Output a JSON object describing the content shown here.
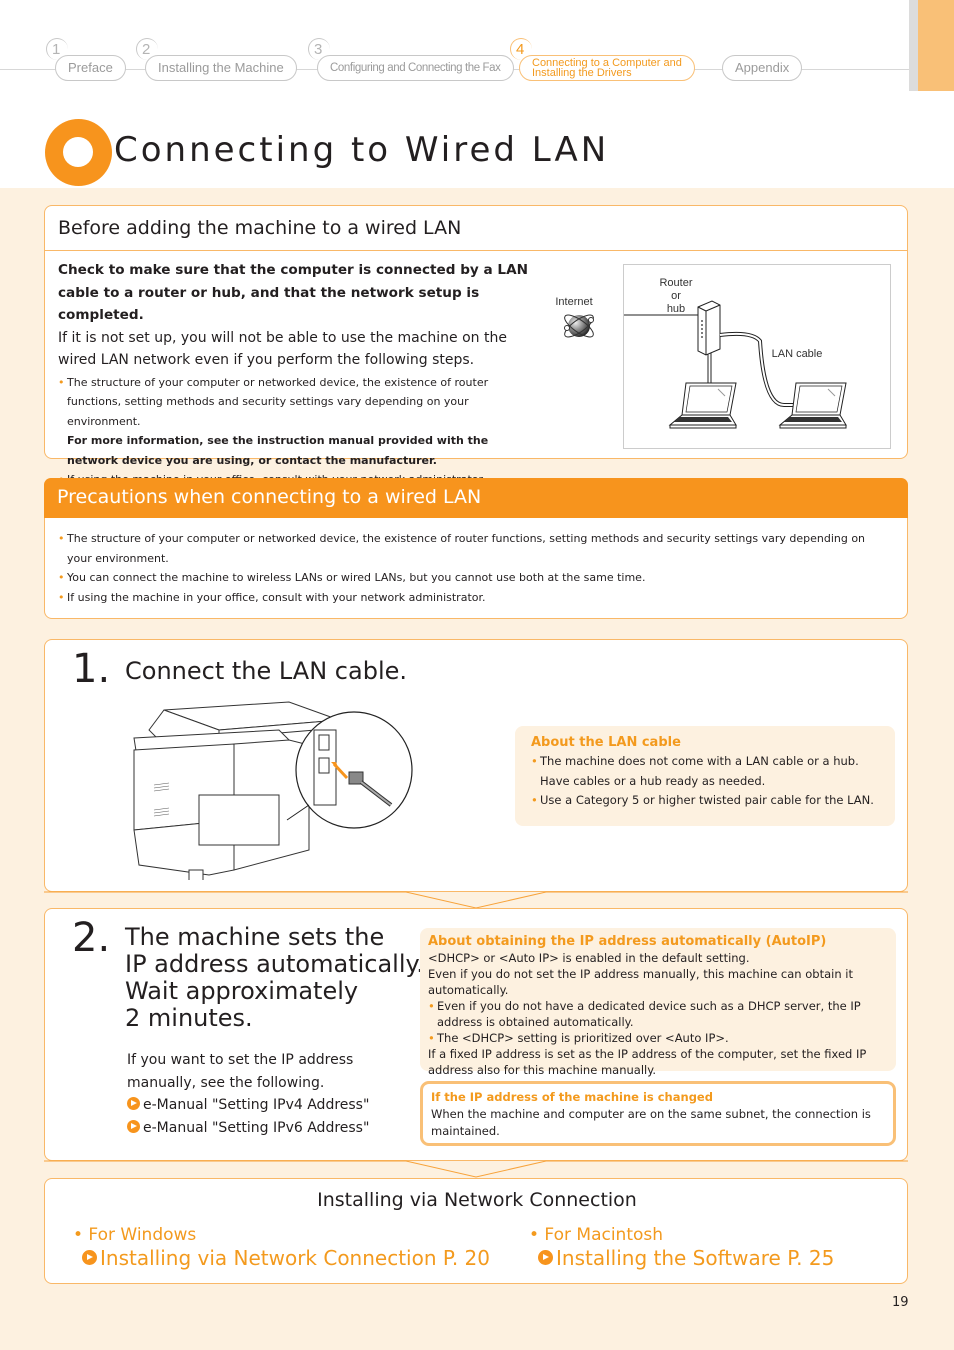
{
  "nav": {
    "steps": [
      {
        "number": "1",
        "label": "Preface"
      },
      {
        "number": "2",
        "label": "Installing the Machine"
      },
      {
        "number": "3",
        "label": "Configuring and Connecting the Fax"
      },
      {
        "number": "4",
        "label_line1": "Connecting to a Computer and",
        "label_line2": "Installing the Drivers",
        "active": true
      },
      {
        "label": "Appendix"
      }
    ]
  },
  "page_title": "Connecting to Wired LAN",
  "before": {
    "heading": "Before adding the machine to a wired LAN",
    "bold_intro": "Check to make sure that the computer is connected by a LAN cable to a router or hub, and that the network setup is completed.",
    "intro": "If it is not set up, you will not be able to use the machine on the wired LAN network even if you perform the following steps.",
    "bullet1": "The structure of your computer or networked device, the existence of router functions, setting methods and security settings vary depending on your environment.",
    "bullet1_bold": "For more information, see the instruction manual provided with the network device you are using, or contact the manufacturer.",
    "bullet2": "If using the machine in your office, consult with your network administrator.",
    "diagram": {
      "internet": "Internet",
      "router_line1": "Router",
      "router_line2": "or",
      "router_line3": "hub",
      "lan_cable": "LAN cable"
    }
  },
  "precautions": {
    "heading": "Precautions when connecting to a wired LAN",
    "bullets": [
      "The structure of your computer or networked device, the existence of router functions, setting methods and security settings vary depending on your environment.",
      "You can connect the machine to wireless LANs or wired LANs, but you cannot use both at the same time.",
      "If using the machine in your office, consult with your network administrator."
    ]
  },
  "step1": {
    "number": "1.",
    "title": "Connect the LAN cable.",
    "note": {
      "title": "About the LAN cable",
      "bullet1_line1": "The machine does not come with a LAN cable or a hub.",
      "bullet1_line2": "Have cables or a hub ready as needed.",
      "bullet2": "Use a Category 5 or higher twisted pair cable for the LAN."
    }
  },
  "step2": {
    "number": "2.",
    "title_lines": [
      "The machine sets the",
      "IP address automatically.",
      "Wait approximately",
      "2 minutes."
    ],
    "sub_text": "If you want to set the IP address manually, see the following.",
    "links": [
      "e-Manual \"Setting IPv4 Address\"",
      "e-Manual \"Setting IPv6 Address\""
    ],
    "auto_note": {
      "title": "About obtaining the IP address automatically (AutoIP)",
      "line1": "<DHCP> or <Auto IP> is enabled in the default setting.",
      "line2": "Even if you do not set the IP address manually, this machine can obtain it automatically.",
      "bullets": [
        "Even if you do not have a dedicated device such as a DHCP server, the IP address is obtained automatically.",
        "The <DHCP> setting is prioritized over <Auto IP>."
      ],
      "line3": "If a fixed IP address is set as the IP address of the computer, set the fixed IP address also for this machine manually."
    },
    "changed_note": {
      "title": "If the IP address of the machine is changed",
      "text": "When the machine and computer are on the same subnet, the connection is maintained."
    }
  },
  "install": {
    "heading": "Installing via Network Connection",
    "windows_label": "• For Windows",
    "windows_link": "Installing via Network Connection P. 20",
    "mac_label": "• For Macintosh",
    "mac_link": "Installing the Software P. 25"
  },
  "page_number": "19",
  "colors": {
    "accent": "#f7941d",
    "accent_light": "#f9c077",
    "background": "#fdf1e0"
  }
}
